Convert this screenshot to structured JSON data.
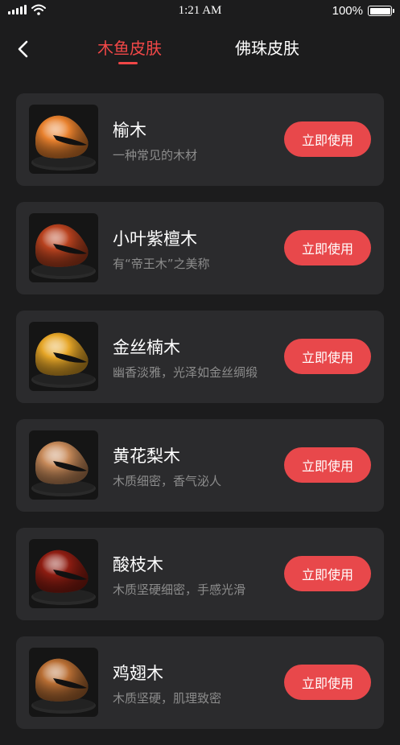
{
  "status_bar": {
    "time": "1:21 AM",
    "battery_text": "100%",
    "battery_level": 1.0,
    "icons": [
      "signal-icon",
      "wifi-icon",
      "battery-icon"
    ]
  },
  "nav": {
    "back_icon": "chevron-left-icon",
    "tabs": [
      {
        "label": "木鱼皮肤",
        "active": true
      },
      {
        "label": "佛珠皮肤",
        "active": false
      }
    ],
    "active_color": "#f04747"
  },
  "skins": [
    {
      "name": "榆木",
      "desc": "一种常见的木材",
      "button": "立即使用",
      "color": "#e8812e"
    },
    {
      "name": "小叶紫檀木",
      "desc": "有“帝王木”之美称",
      "button": "立即使用",
      "color": "#b8421f"
    },
    {
      "name": "金丝楠木",
      "desc": "幽香淡雅，光泽如金丝绸缎",
      "button": "立即使用",
      "color": "#e6a628"
    },
    {
      "name": "黄花梨木",
      "desc": "木质细密，香气泌人",
      "button": "立即使用",
      "color": "#c78a5a"
    },
    {
      "name": "酸枝木",
      "desc": "木质坚硬细密，手感光滑",
      "button": "立即使用",
      "color": "#8e1d12"
    },
    {
      "name": "鸡翅木",
      "desc": "木质坚硬，肌理致密",
      "button": "立即使用",
      "color": "#b86e34"
    }
  ],
  "colors": {
    "background": "#1c1c1d",
    "card": "#2b2b2d",
    "button": "#e8484b",
    "secondary_text": "#8c8c8c"
  }
}
